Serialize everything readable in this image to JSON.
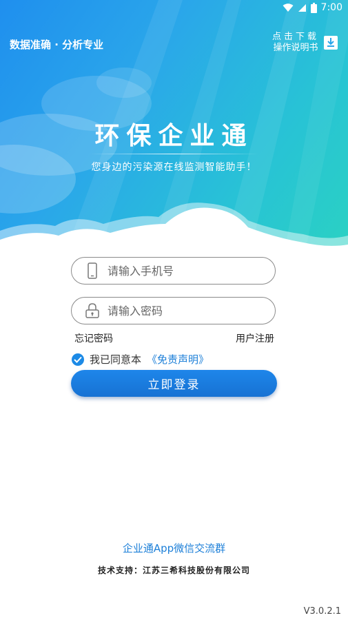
{
  "status_bar": {
    "time": "7:00",
    "icons": [
      "wifi-icon",
      "signal-icon",
      "battery-icon"
    ]
  },
  "header": {
    "tagline": "数据准确 · 分析专业",
    "manual_line1": "点击下载",
    "manual_line2": "操作说明书",
    "manual_icon": "download-icon"
  },
  "hero": {
    "title": "环保企业通",
    "subtitle": "您身边的污染源在线监测智能助手！"
  },
  "login": {
    "phone_placeholder": "请输入手机号",
    "password_placeholder": "请输入密码",
    "forgot_password": "忘记密码",
    "register": "用户注册",
    "agree_text": "我已同意本",
    "disclaimer": "《免责声明》",
    "agreed": true,
    "login_button": "立即登录"
  },
  "footer": {
    "wechat_group": "企业通App微信交流群",
    "support": "技术支持：江苏三希科技股份有限公司",
    "version": "V3.0.2.1"
  },
  "colors": {
    "accent": "#1c7fd8",
    "hero_start": "#1f8fee",
    "hero_end": "#2ad2c2"
  }
}
